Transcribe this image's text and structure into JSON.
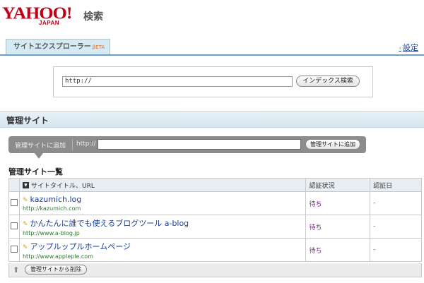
{
  "header": {
    "logo_main": "YAHOO!",
    "logo_sub": "JAPAN",
    "logo_kensaku": "検索",
    "tab_label": "サイトエクスプローラー",
    "tab_beta": "βETA",
    "setting_link": "設定"
  },
  "index_search": {
    "input_value": "http://",
    "button_label": "インデックス検索"
  },
  "section": {
    "title": "管理サイト"
  },
  "add_site": {
    "label": "管理サイトに追加",
    "prefix": "http://",
    "button_label": "管理サイトに追加"
  },
  "list": {
    "title": "管理サイト一覧",
    "headers": {
      "title_url": "サイトタイトル、URL",
      "status": "認証状況",
      "date": "認証日"
    },
    "rows": [
      {
        "title": "kazumich.log",
        "url": "http://kazumich.com",
        "status": "待ち",
        "date": "-"
      },
      {
        "title": "かんたんに誰でも使えるブログツール a-blog",
        "url": "http://www.a-blog.jp",
        "status": "待ち",
        "date": "-"
      },
      {
        "title": "アップルップルホームページ",
        "url": "http://www.appleple.com",
        "status": "待ち",
        "date": "-"
      }
    ],
    "delete_button": "管理サイトから削除"
  },
  "colors": {
    "logo_red": "#c20015",
    "link_blue": "#1a3d9c",
    "url_green": "#2a7a2a",
    "status_purple": "#7a2a8a"
  },
  "icons": [
    "sort-icon",
    "pencil-icon",
    "up-arrow-icon",
    "checkbox"
  ]
}
